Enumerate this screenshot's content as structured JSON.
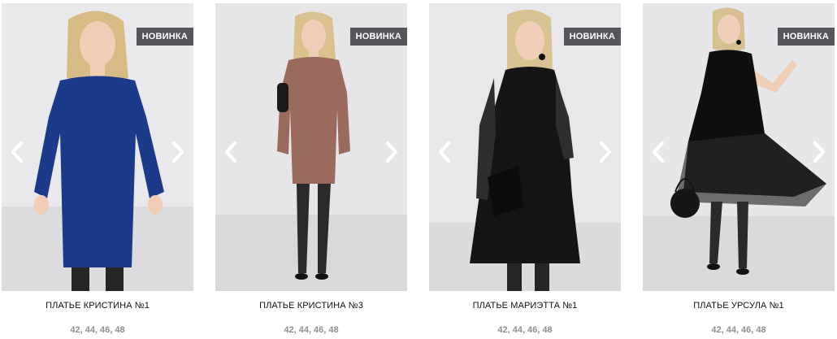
{
  "products": [
    {
      "badge": "НОВИНКА",
      "title": "ПЛАТЬЕ КРИСТИНА №1",
      "sizes": "42, 44, 46, 48",
      "dress_color": "#1b3a8a",
      "bg_color": "#e9e9ec"
    },
    {
      "badge": "НОВИНКА",
      "title": "ПЛАТЬЕ КРИСТИНА №3",
      "sizes": "42, 44, 46, 48",
      "dress_color": "#9a6a5c",
      "bg_color": "#e6e6e8"
    },
    {
      "badge": "НОВИНКА",
      "title": "ПЛАТЬЕ МАРИЭТТА №1",
      "sizes": "42, 44, 46, 48",
      "dress_color": "#151515",
      "bg_color": "#e8e8ea"
    },
    {
      "badge": "НОВИНКА",
      "title": "ПЛАТЬЕ УРСУЛА №1",
      "sizes": "42, 44, 46, 48",
      "dress_color": "#0f0f10",
      "bg_color": "#e7e7e9"
    }
  ]
}
